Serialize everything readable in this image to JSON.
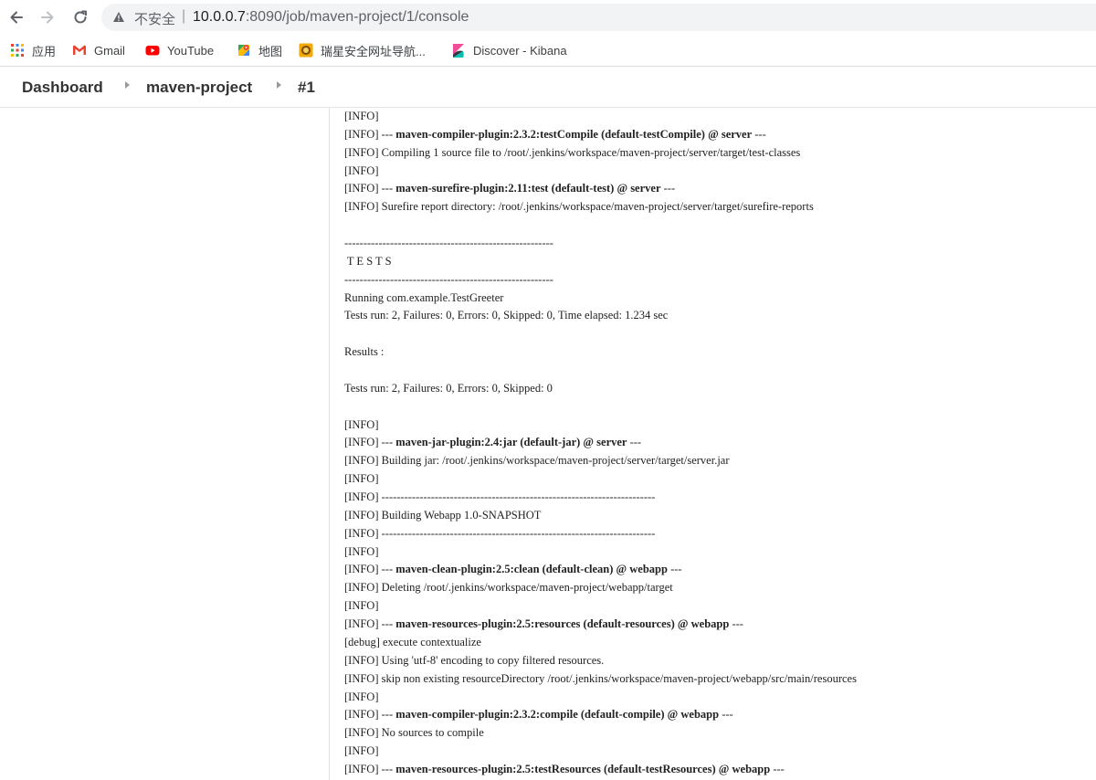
{
  "browser": {
    "insecure_label": "不安全",
    "url_host": "10.0.0.7",
    "url_rest": ":8090/job/maven-project/1/console"
  },
  "bookmarks": [
    {
      "label": "应用",
      "icon": "apps-grid-icon"
    },
    {
      "label": "Gmail",
      "icon": "gmail-icon"
    },
    {
      "label": "YouTube",
      "icon": "youtube-icon"
    },
    {
      "label": "地图",
      "icon": "maps-icon"
    },
    {
      "label": "瑞星安全网址导航...",
      "icon": "rising-lion-icon"
    },
    {
      "label": "Discover - Kibana",
      "icon": "kibana-icon"
    }
  ],
  "breadcrumb": [
    "Dashboard",
    "maven-project",
    "#1"
  ],
  "console_lines": [
    {
      "pre": "[INFO]",
      "bold": "",
      "post": ""
    },
    {
      "pre": "[INFO] --- ",
      "bold": "maven-compiler-plugin:2.3.2:testCompile (default-testCompile) @ server",
      "post": " ---"
    },
    {
      "pre": "[INFO] Compiling 1 source file to /root/.jenkins/workspace/maven-project/server/target/test-classes",
      "bold": "",
      "post": ""
    },
    {
      "pre": "[INFO]",
      "bold": "",
      "post": ""
    },
    {
      "pre": "[INFO] --- ",
      "bold": "maven-surefire-plugin:2.11:test (default-test) @ server",
      "post": " ---"
    },
    {
      "pre": "[INFO] Surefire report directory: /root/.jenkins/workspace/maven-project/server/target/surefire-reports",
      "bold": "",
      "post": ""
    },
    {
      "pre": "",
      "bold": "",
      "post": ""
    },
    {
      "pre": "-------------------------------------------------------",
      "bold": "",
      "post": ""
    },
    {
      "pre": " T E S T S",
      "bold": "",
      "post": ""
    },
    {
      "pre": "-------------------------------------------------------",
      "bold": "",
      "post": ""
    },
    {
      "pre": "Running com.example.TestGreeter",
      "bold": "",
      "post": ""
    },
    {
      "pre": "Tests run: 2, Failures: 0, Errors: 0, Skipped: 0, Time elapsed: 1.234 sec",
      "bold": "",
      "post": ""
    },
    {
      "pre": "",
      "bold": "",
      "post": ""
    },
    {
      "pre": "Results :",
      "bold": "",
      "post": ""
    },
    {
      "pre": "",
      "bold": "",
      "post": ""
    },
    {
      "pre": "Tests run: 2, Failures: 0, Errors: 0, Skipped: 0",
      "bold": "",
      "post": ""
    },
    {
      "pre": "",
      "bold": "",
      "post": ""
    },
    {
      "pre": "[INFO]",
      "bold": "",
      "post": ""
    },
    {
      "pre": "[INFO] --- ",
      "bold": "maven-jar-plugin:2.4:jar (default-jar) @ server",
      "post": " ---"
    },
    {
      "pre": "[INFO] Building jar: /root/.jenkins/workspace/maven-project/server/target/server.jar",
      "bold": "",
      "post": ""
    },
    {
      "pre": "[INFO]",
      "bold": "",
      "post": ""
    },
    {
      "pre": "[INFO] ------------------------------------------------------------------------",
      "bold": "",
      "post": ""
    },
    {
      "pre": "[INFO] Building Webapp 1.0-SNAPSHOT",
      "bold": "",
      "post": ""
    },
    {
      "pre": "[INFO] ------------------------------------------------------------------------",
      "bold": "",
      "post": ""
    },
    {
      "pre": "[INFO]",
      "bold": "",
      "post": ""
    },
    {
      "pre": "[INFO] --- ",
      "bold": "maven-clean-plugin:2.5:clean (default-clean) @ webapp",
      "post": " ---"
    },
    {
      "pre": "[INFO] Deleting /root/.jenkins/workspace/maven-project/webapp/target",
      "bold": "",
      "post": ""
    },
    {
      "pre": "[INFO]",
      "bold": "",
      "post": ""
    },
    {
      "pre": "[INFO] --- ",
      "bold": "maven-resources-plugin:2.5:resources (default-resources) @ webapp",
      "post": " ---"
    },
    {
      "pre": "[debug] execute contextualize",
      "bold": "",
      "post": ""
    },
    {
      "pre": "[INFO] Using 'utf-8' encoding to copy filtered resources.",
      "bold": "",
      "post": ""
    },
    {
      "pre": "[INFO] skip non existing resourceDirectory /root/.jenkins/workspace/maven-project/webapp/src/main/resources",
      "bold": "",
      "post": ""
    },
    {
      "pre": "[INFO]",
      "bold": "",
      "post": ""
    },
    {
      "pre": "[INFO] --- ",
      "bold": "maven-compiler-plugin:2.3.2:compile (default-compile) @ webapp",
      "post": " ---"
    },
    {
      "pre": "[INFO] No sources to compile",
      "bold": "",
      "post": ""
    },
    {
      "pre": "[INFO]",
      "bold": "",
      "post": ""
    },
    {
      "pre": "[INFO] --- ",
      "bold": "maven-resources-plugin:2.5:testResources (default-testResources) @ webapp",
      "post": " ---"
    }
  ]
}
